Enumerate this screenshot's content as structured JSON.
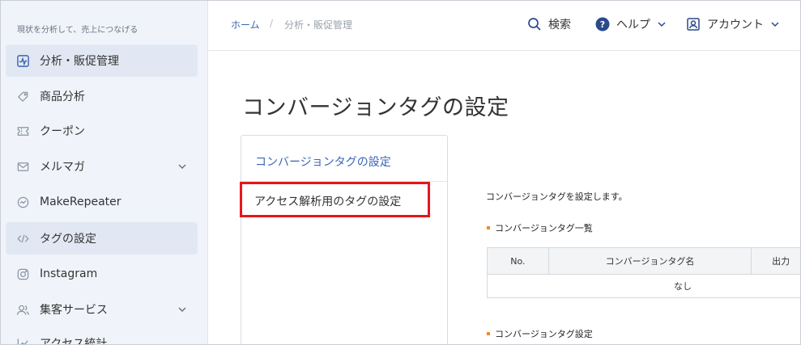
{
  "sidebar": {
    "tagline": "現状を分析して、売上につなげる",
    "items": [
      {
        "label": "分析・販促管理",
        "icon": "activity-icon"
      },
      {
        "label": "商品分析",
        "icon": "tag-icon"
      },
      {
        "label": "クーポン",
        "icon": "coupon-icon"
      },
      {
        "label": "メルマガ",
        "icon": "mail-icon"
      },
      {
        "label": "MakeRepeater",
        "icon": "gauge-icon"
      },
      {
        "label": "タグの設定",
        "icon": "code-icon"
      },
      {
        "label": "Instagram",
        "icon": "instagram-icon"
      },
      {
        "label": "集客サービス",
        "icon": "users-icon"
      },
      {
        "label": "アクセス統計",
        "icon": "chart-icon"
      }
    ]
  },
  "header": {
    "breadcrumb_home": "ホーム",
    "breadcrumb_sep": "/",
    "breadcrumb_current": "分析・販促管理",
    "search_label": "検索",
    "help_label": "ヘルプ",
    "account_label": "アカウント"
  },
  "main": {
    "title": "コンバージョンタグの設定",
    "tabs": [
      {
        "label": "コンバージョンタグの設定"
      },
      {
        "label": "アクセス解析用のタグの設定"
      }
    ],
    "description": "コンバージョンタグを設定します。",
    "section_list_title": "コンバージョンタグ一覧",
    "table": {
      "headers": [
        "No.",
        "コンバージョンタグ名",
        "出力"
      ],
      "empty_text": "なし"
    },
    "section_settings_title": "コンバージョンタグ設定"
  },
  "colors": {
    "accent": "#3a64b6",
    "highlight": "#e8151b",
    "bullet": "#f08a24",
    "sidebar_bg": "#f0f4fa"
  }
}
